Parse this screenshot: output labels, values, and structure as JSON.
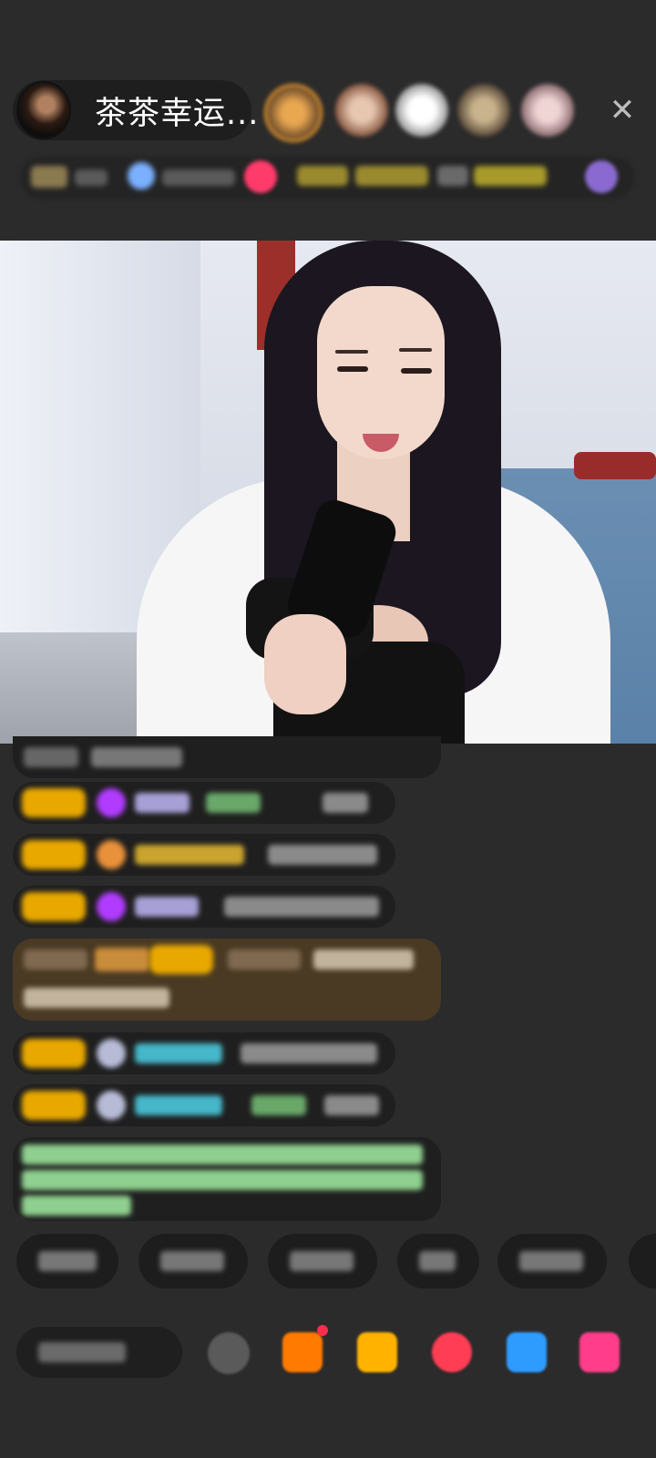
{
  "header": {
    "host_name": "茶茶幸运...",
    "close_icon": "close-icon",
    "viewers": [
      {
        "name": "viewer-1",
        "color": "#c9872f"
      },
      {
        "name": "viewer-2",
        "color": "#b58570"
      },
      {
        "name": "viewer-3",
        "color": "#d7d7d7"
      },
      {
        "name": "viewer-4",
        "color": "#9c8a6a"
      },
      {
        "name": "viewer-5",
        "color": "#c7a5a5"
      }
    ]
  },
  "stream": {
    "description_icon": "live-video"
  },
  "chat": {
    "messages": [
      {
        "type": "system"
      },
      {
        "type": "user",
        "badge_color": "#e8a800",
        "gem_color": "#b13cff",
        "name_color": "#a7a0d6"
      },
      {
        "type": "user",
        "badge_color": "#e8a800",
        "gem_color": "#e8913a",
        "name_color": "#c9a42e"
      },
      {
        "type": "user",
        "badge_color": "#e8a800",
        "gem_color": "#b13cff",
        "name_color": "#a7a0d6"
      },
      {
        "type": "highlight",
        "bg_color": "#4a3a23"
      },
      {
        "type": "user",
        "badge_color": "#e8a800",
        "gem_color": "#b7bbd6",
        "name_color": "#46b7c9"
      },
      {
        "type": "user",
        "badge_color": "#e8a800",
        "gem_color": "#b7bbd6",
        "name_color": "#46b7c9"
      },
      {
        "type": "notice",
        "text_color": "#8fcf8f"
      }
    ]
  },
  "quick_replies": {
    "count": 6
  },
  "bottom_bar": {
    "icons": [
      "emoji-icon",
      "gift-box-icon",
      "treasure-icon",
      "heart-icon",
      "game-icon",
      "shop-icon"
    ],
    "accent_colors": [
      "#ff7a00",
      "#ffb300",
      "#ff3d55",
      "#2e9cff",
      "#ff3d8a"
    ]
  }
}
